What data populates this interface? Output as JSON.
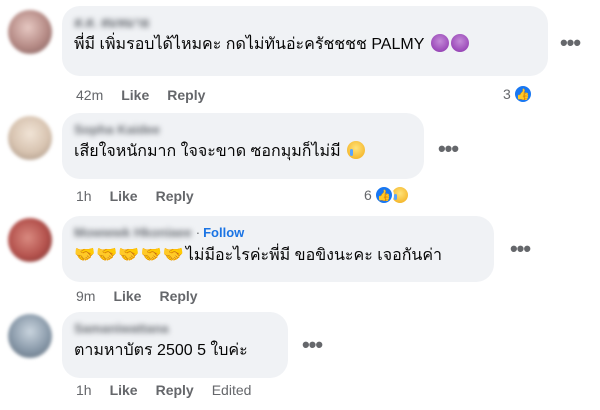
{
  "comments": [
    {
      "author": "ส.ส. สมหมาย",
      "text": "พี่มี เพิ่มรอบได้ไหมคะ กดไม่ทันอ่ะครัชชชช PALMY",
      "emoji": [
        "sick-face-emoji",
        "sick-face-emoji"
      ],
      "time": "42m",
      "like_label": "Like",
      "reply_label": "Reply",
      "reactions": {
        "count": "3",
        "types": [
          "like"
        ]
      },
      "avatar_color": "#b58a85"
    },
    {
      "author": "Sopha Kaidee",
      "text": "เสียใจหนักมาก ใจจะขาด ซอกมุมก็ไม่มี",
      "emoji": [
        "crying-face-emoji"
      ],
      "time": "1h",
      "like_label": "Like",
      "reply_label": "Reply",
      "reactions": {
        "count": "6",
        "types": [
          "like",
          "sad"
        ]
      },
      "avatar_color": "#d7c3b0"
    },
    {
      "author": "Mowwwk Hkoniaee",
      "follow_label": "Follow",
      "dot": "·",
      "prefix_icon": "🤝🤝🤝🤝🤝",
      "text": "ไม่มีอะไรค่ะพี่มี ขอขิงนะคะ เจอกันค่า",
      "time": "9m",
      "like_label": "Like",
      "reply_label": "Reply",
      "avatar_color": "#b4524d"
    },
    {
      "author": "Samaniwattana",
      "text": "ตามหาบัตร 2500 5 ใบค่ะ",
      "time": "1h",
      "like_label": "Like",
      "reply_label": "Reply",
      "edited_label": "Edited",
      "avatar_color": "#8a9aaa"
    }
  ],
  "more_label": "•••"
}
